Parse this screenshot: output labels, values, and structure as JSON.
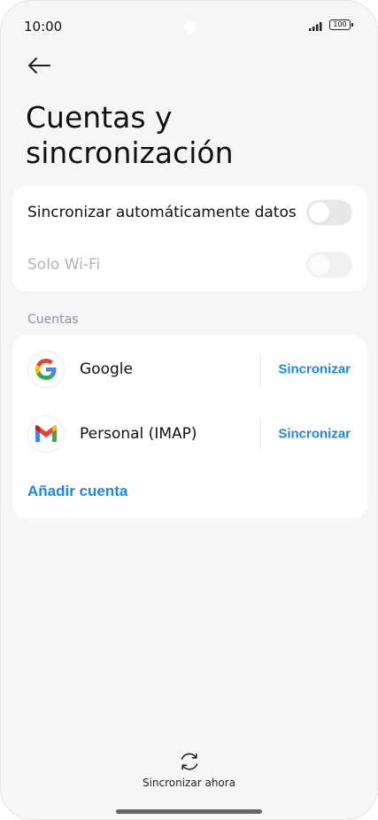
{
  "status_bar": {
    "time": "10:00",
    "battery": "100"
  },
  "header": {
    "back_icon": "arrow-left-icon",
    "title": "Cuentas y sincronización"
  },
  "sync_settings": {
    "auto_sync": {
      "label": "Sincronizar automáticamente datos",
      "enabled": false
    },
    "wifi_only": {
      "label": "Solo Wi-Fi",
      "enabled": false,
      "disabled": true
    }
  },
  "accounts": {
    "section_label": "Cuentas",
    "items": [
      {
        "name": "Google",
        "icon": "google-icon",
        "action": "Sincronizar"
      },
      {
        "name": "Personal (IMAP)",
        "icon": "gmail-icon",
        "action": "Sincronizar"
      }
    ],
    "add_label": "Añadir cuenta"
  },
  "footer": {
    "sync_now_label": "Sincronizar ahora",
    "sync_now_icon": "refresh-icon"
  },
  "colors": {
    "accent": "#1e88e5",
    "background": "#f6f6f6",
    "card": "#ffffff",
    "section_label": "#8a91a0"
  }
}
